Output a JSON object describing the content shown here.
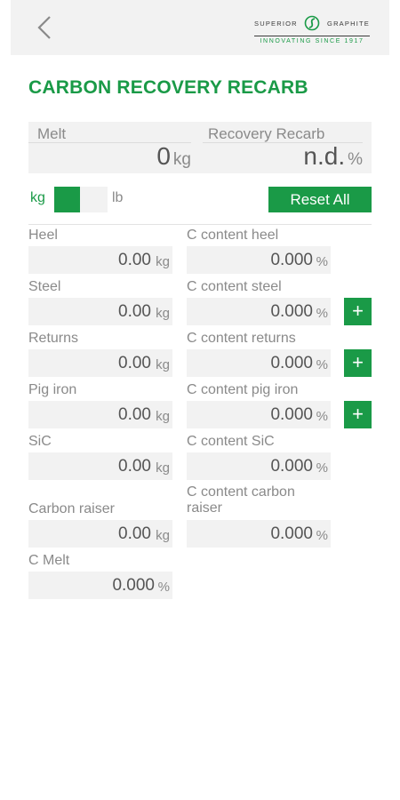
{
  "header": {
    "back_icon": "chevron-left-icon",
    "logo": {
      "left": "SUPERIOR",
      "right": "GRAPHITE",
      "tagline": "INNOVATING SINCE 1917"
    },
    "title": "CARBON RECOVERY RECARB"
  },
  "summary": {
    "melt_label": "Melt",
    "melt_value": "0",
    "melt_unit": "kg",
    "recovery_label": "Recovery Recarb",
    "recovery_value": "n.d.",
    "recovery_unit": "%"
  },
  "units": {
    "kg_label": "kg",
    "lb_label": "lb",
    "selected": "kg",
    "reset_label": "Reset All"
  },
  "inputs": [
    {
      "label": "Heel",
      "value": "0.00",
      "unit": "kg",
      "c_label": "C content heel",
      "c_value": "0.000",
      "c_unit": "%",
      "has_add": false
    },
    {
      "label": "Steel",
      "value": "0.00",
      "unit": "kg",
      "c_label": "C content steel",
      "c_value": "0.000",
      "c_unit": "%",
      "has_add": true
    },
    {
      "label": "Returns",
      "value": "0.00",
      "unit": "kg",
      "c_label": "C content returns",
      "c_value": "0.000",
      "c_unit": "%",
      "has_add": true
    },
    {
      "label": "Pig iron",
      "value": "0.00",
      "unit": "kg",
      "c_label": "C content pig iron",
      "c_value": "0.000",
      "c_unit": "%",
      "has_add": true
    },
    {
      "label": "SiC",
      "value": "0.00",
      "unit": "kg",
      "c_label": "C content SiC",
      "c_value": "0.000",
      "c_unit": "%",
      "has_add": false
    },
    {
      "label": "Carbon raiser",
      "value": "0.00",
      "unit": "kg",
      "c_label": "C content carbon raiser",
      "c_value": "0.000",
      "c_unit": "%",
      "has_add": false
    }
  ],
  "c_melt": {
    "label": "C Melt",
    "value": "0.000",
    "unit": "%"
  },
  "add_label": "+",
  "colors": {
    "accent": "#1a9a47",
    "field_bg": "#f2f2f2",
    "label": "#8a8a8a"
  }
}
